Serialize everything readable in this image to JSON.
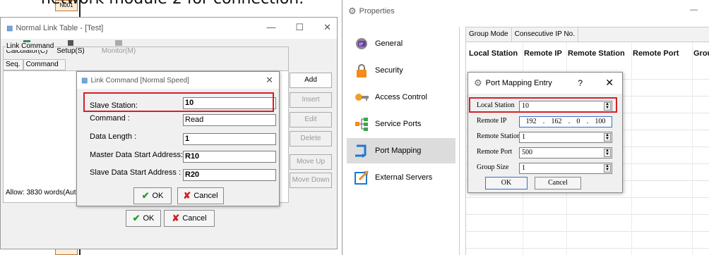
{
  "caption": "network module 2 for connection.",
  "ladder": {
    "block_label": "N001"
  },
  "left_window": {
    "title": "Normal Link Table - [Test]",
    "toolbar": [
      {
        "label": "Calculator(C)",
        "enabled": true
      },
      {
        "label": "Setup(S)",
        "enabled": true
      },
      {
        "label": "Monitor(M)",
        "enabled": false
      }
    ],
    "group_legend": "Link Command",
    "columns": [
      "Seq.",
      "Command"
    ],
    "allow_text": "Allow: 3830 words(Auto",
    "side_buttons": {
      "add": "Add",
      "insert": "Insert",
      "edit": "Edit",
      "delete": "Delete",
      "move_up": "Move Up",
      "move_down": "Move Down"
    },
    "ok": "OK",
    "cancel": "Cancel"
  },
  "link_dialog": {
    "title": "Link Command [Normal Speed]",
    "fields": {
      "slave_station": {
        "label": "Slave Station:",
        "value": "10"
      },
      "command": {
        "label": "Command :",
        "value": "Read"
      },
      "data_length": {
        "label": "Data Length :",
        "value": "1"
      },
      "master_start": {
        "label": "Master Data Start Address:",
        "value": "R10"
      },
      "slave_start": {
        "label": "Slave Data Start Address :",
        "value": "R20"
      }
    },
    "ok": "OK",
    "cancel": "Cancel"
  },
  "properties": {
    "title": "Properties",
    "nav": [
      {
        "label": "General",
        "icon": "general-icon"
      },
      {
        "label": "Security",
        "icon": "lock-icon"
      },
      {
        "label": "Access Control",
        "icon": "key-icon"
      },
      {
        "label": "Service Ports",
        "icon": "service-ports-icon"
      },
      {
        "label": "Port Mapping",
        "icon": "port-mapping-icon",
        "selected": true
      },
      {
        "label": "External Servers",
        "icon": "external-servers-icon"
      }
    ],
    "group_mode_label": "Group Mode",
    "group_mode_value": "Consecutive IP No.",
    "table_headers": [
      "Local Station",
      "Remote IP",
      "Remote Station",
      "Remote Port",
      "Grou"
    ]
  },
  "port_mapping_dialog": {
    "title": "Port Mapping Entry",
    "help": "?",
    "fields": {
      "local_station": {
        "label": "Local Station",
        "value": "10"
      },
      "remote_ip": {
        "label": "Remote IP",
        "octets": [
          "192",
          "162",
          "0",
          "100"
        ]
      },
      "remote_station": {
        "label": "Remote Station",
        "value": "1"
      },
      "remote_port": {
        "label": "Remote Port",
        "value": "500"
      },
      "group_size": {
        "label": "Group Size",
        "value": "1"
      }
    },
    "ok": "OK",
    "cancel": "Cancel"
  },
  "colors": {
    "highlight_red": "#d42027",
    "selected_nav": "#dcdcdc"
  }
}
